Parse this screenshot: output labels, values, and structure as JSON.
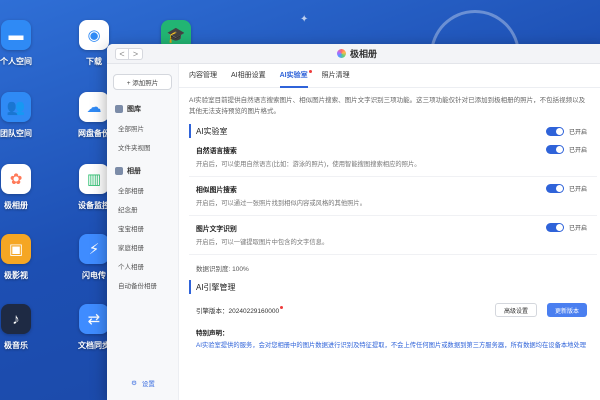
{
  "desktop": {
    "icons": [
      {
        "label": "个人空间",
        "icon": "folder-icon",
        "color": "#2f8af5"
      },
      {
        "label": "下载",
        "icon": "download-globe-icon",
        "color": "#ffffff"
      },
      {
        "label": "团队空间",
        "icon": "team-folder-icon",
        "color": "#2f8af5"
      },
      {
        "label": "网盘备份",
        "icon": "cloud-backup-icon",
        "color": "#ffffff"
      },
      {
        "label": "极相册",
        "icon": "photos-flower-icon",
        "color": "#ffffff"
      },
      {
        "label": "设备监控",
        "icon": "device-monitor-icon",
        "color": "#ffffff"
      },
      {
        "label": "极影视",
        "icon": "video-icon",
        "color": "#f5a623"
      },
      {
        "label": "闪电传",
        "icon": "flash-transfer-icon",
        "color": "#3f8cff"
      },
      {
        "label": "极音乐",
        "icon": "music-icon",
        "color": "#1e2a44"
      },
      {
        "label": "文档同步",
        "icon": "doc-sync-icon",
        "color": "#3f8cff"
      },
      {
        "label": "",
        "icon": "graduation-cap-icon",
        "color": "#22b573"
      }
    ]
  },
  "window": {
    "title": "极相册",
    "nav_back": "<",
    "nav_forward": ">"
  },
  "sidebar": {
    "add_photo": "+ 添加照片",
    "library_header": "图库",
    "library_items": [
      "全部照片",
      "文件夹视图"
    ],
    "album_header": "相册",
    "album_items": [
      "全部相册",
      "纪念册",
      "宝宝相册",
      "家庭相册",
      "个人相册",
      "自动备份相册"
    ],
    "settings": "设置"
  },
  "tabs": [
    {
      "label": "内容管理",
      "active": false
    },
    {
      "label": "AI相册设置",
      "active": false
    },
    {
      "label": "AI实验室",
      "active": true
    },
    {
      "label": "照片清理",
      "active": false
    }
  ],
  "content": {
    "intro": "AI实验室目前提供自然语言搜索图片、相似图片搜索、图片文字识别三项功能。这三项功能仅针对已添加到极相册的照片，不包括视频以及其他无法支持预览的图片格式。",
    "lab_title": "AI实验室",
    "lab_switch": "已开启",
    "features": [
      {
        "title": "自然语言搜索",
        "desc": "开启后，可以使用自然语言(比如：游泳的照片)，使用智能搜图搜索相应的照片。",
        "switch": "已开启"
      },
      {
        "title": "相似图片搜索",
        "desc": "开启后，可以通过一张照片找到相似内容或风格的其他照片。",
        "switch": "已开启"
      },
      {
        "title": "图片文字识别",
        "desc": "开启后，可以一键提取图片中包含的文字信息。",
        "switch": "已开启"
      }
    ],
    "progress_label": "数据识别度: 100%",
    "engine_title": "AI引擎管理",
    "engine_version": "引擎版本：20240229160000",
    "btn_advanced": "高级设置",
    "btn_update": "更新版本",
    "notice_title": "特别声明：",
    "notice_text": "AI实验室提供的服务，会对您相册中的图片数据进行识别及特征提取，不会上传任何图片或数据到第三方服务器，所有数据均在设备本地处理"
  }
}
